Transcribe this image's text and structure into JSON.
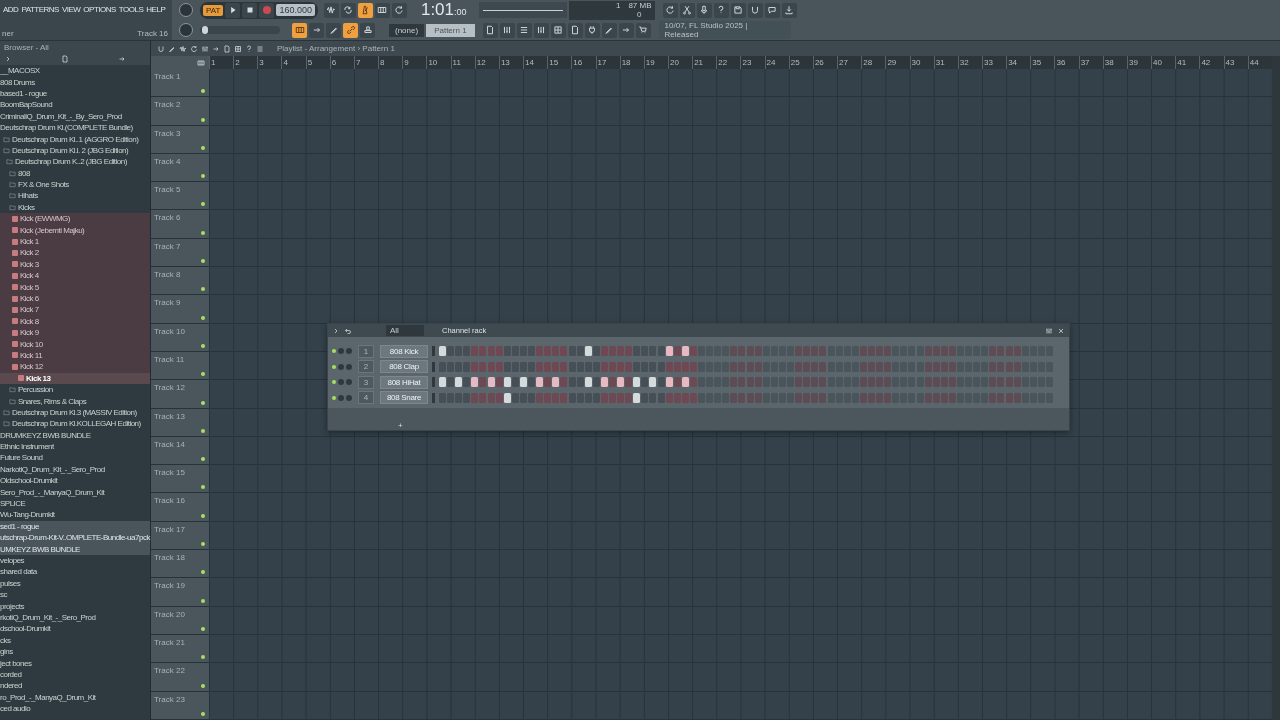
{
  "menu": [
    "ADD",
    "PATTERNS",
    "VIEW",
    "OPTIONS",
    "TOOLS",
    "HELP"
  ],
  "hint_bar": {
    "text": "ner",
    "track": "Track 16"
  },
  "transport": {
    "mode": "PAT",
    "tempo": "160.000",
    "time": "1:01$_{:00}$"
  },
  "toggles_top": [
    {
      "on": false
    },
    {
      "on": false
    },
    {
      "on": true
    },
    {
      "on": false
    },
    {
      "on": false
    }
  ],
  "toggles_bottom": [
    {
      "on": true
    },
    {
      "on": false
    },
    {
      "on": false
    },
    {
      "on": true
    },
    {
      "on": false
    }
  ],
  "master_pitch": {
    "level": 0.03
  },
  "pattern_picker": {
    "snap": "(none)",
    "pattern": "Pattern 1"
  },
  "monitor": {
    "cpu": "1",
    "memory": "87 MB",
    "voices": "0"
  },
  "news": {
    "line_1": "10/07, FL Studio 2025 |",
    "line_2": "Released"
  },
  "browser": {
    "title": "Browser - All",
    "tree": [
      {
        "label": "__MACOSX",
        "kind": "plain",
        "selected": false
      },
      {
        "label": "808 Drums",
        "kind": "plain",
        "selected": false
      },
      {
        "label": "based1 - rogue",
        "kind": "plain",
        "selected": false
      },
      {
        "label": "BoomBapSound",
        "kind": "plain",
        "selected": false
      },
      {
        "label": "CriminaliQ_Drum_Kit_-_By_Sero_Prod",
        "kind": "plain",
        "selected": false
      },
      {
        "label": "Deutschrap Drum Kl.(COMPLETE Bundle)",
        "kind": "plain",
        "selected": false,
        "children": [
          {
            "label": "Deutschrap Drum Kl..1 (AGGRO Edition)",
            "kind": "folder",
            "selected": false
          },
          {
            "label": "Deutschrap Drum Kl.l. 2 (JBG Edition)",
            "kind": "folder",
            "selected": false,
            "children": [
              {
                "label": "Deutschrap Drum K..2 (JBG Edition)",
                "kind": "folder",
                "selected": false,
                "children": [
                  {
                    "label": "808",
                    "kind": "folder",
                    "selected": false
                  },
                  {
                    "label": "FX & One Shots",
                    "kind": "folder",
                    "selected": false
                  },
                  {
                    "label": "Hihats",
                    "kind": "folder",
                    "selected": false
                  },
                  {
                    "label": "Kicks",
                    "kind": "folder",
                    "selected": false,
                    "children": [
                      {
                        "label": "Kick (EWWMG)",
                        "kind": "file",
                        "selected": false
                      },
                      {
                        "label": "Kick (Jebemti Majku)",
                        "kind": "file",
                        "selected": false
                      },
                      {
                        "label": "Kick 1",
                        "kind": "file",
                        "selected": false
                      },
                      {
                        "label": "Kick 2",
                        "kind": "file",
                        "selected": false
                      },
                      {
                        "label": "Kick 3",
                        "kind": "file",
                        "selected": false
                      },
                      {
                        "label": "Kick 4",
                        "kind": "file",
                        "selected": false
                      },
                      {
                        "label": "Kick 5",
                        "kind": "file",
                        "selected": false
                      },
                      {
                        "label": "Kick 6",
                        "kind": "file",
                        "selected": false
                      },
                      {
                        "label": "Kick 7",
                        "kind": "file",
                        "selected": false
                      },
                      {
                        "label": "Kick 8",
                        "kind": "file",
                        "selected": false
                      },
                      {
                        "label": "Kick 9",
                        "kind": "file",
                        "selected": false
                      },
                      {
                        "label": "Kick 10",
                        "kind": "file",
                        "selected": false
                      },
                      {
                        "label": "Kick 11",
                        "kind": "file",
                        "selected": false
                      },
                      {
                        "label": "Kick 12",
                        "kind": "file",
                        "selected": false
                      },
                      {
                        "label": "Kick 13",
                        "kind": "file",
                        "selected": true
                      }
                    ]
                  },
                  {
                    "label": "Percussion",
                    "kind": "folder",
                    "selected": false
                  },
                  {
                    "label": "Snares, Rims & Claps",
                    "kind": "folder",
                    "selected": false
                  }
                ]
              }
            ]
          },
          {
            "label": "Deutschrap Drum Kl.3 (MASSIV Edition)",
            "kind": "folder",
            "selected": false
          },
          {
            "label": "Deutschrap Drum Kl.KOLLEGAH Edition)",
            "kind": "folder",
            "selected": false
          }
        ]
      },
      {
        "label": "DRUMKEYZ BWB BUNDLE",
        "kind": "plain",
        "selected": false
      },
      {
        "label": "Ethnic Instrument",
        "kind": "plain",
        "selected": false
      },
      {
        "label": "Future Sound",
        "kind": "plain",
        "selected": false
      },
      {
        "label": "NarkotiQ_Drum_Kit_-_Sero_Prod",
        "kind": "plain",
        "selected": false
      },
      {
        "label": "Oldschool-Drumkit",
        "kind": "plain",
        "selected": false
      },
      {
        "label": "Sero_Prod_-_ManyaQ_Drum_Kit",
        "kind": "plain",
        "selected": false
      },
      {
        "label": "SPLICE",
        "kind": "plain",
        "selected": false
      },
      {
        "label": "Wu-Tang-Drumkit",
        "kind": "plain",
        "selected": false
      },
      {
        "label": "sed1 - rogue",
        "kind": "recent",
        "selected": false
      },
      {
        "label": "utschrap-Drum-Kit-V..OMPLETE-Bundle-ua7pck",
        "kind": "recent",
        "selected": false
      },
      {
        "label": "UMKEYZ BWB BUNDLE",
        "kind": "recent",
        "selected": false
      },
      {
        "label": "velopes",
        "kind": "plain",
        "selected": false
      },
      {
        "label": "shared data",
        "kind": "plain",
        "selected": false
      },
      {
        "label": "pulses",
        "kind": "plain",
        "selected": false
      },
      {
        "label": "sc",
        "kind": "plain",
        "selected": false
      },
      {
        "label": "projects",
        "kind": "plain",
        "selected": false
      },
      {
        "label": "rkotiQ_Drum_Kit_-_Sero_Prod",
        "kind": "plain",
        "selected": false
      },
      {
        "label": "dschool-Drumkit",
        "kind": "plain",
        "selected": false
      },
      {
        "label": "cks",
        "kind": "plain",
        "selected": false
      },
      {
        "label": "gins",
        "kind": "plain",
        "selected": false
      },
      {
        "label": "ject bones",
        "kind": "plain",
        "selected": false
      },
      {
        "label": "corded",
        "kind": "plain",
        "selected": false
      },
      {
        "label": "ndered",
        "kind": "plain",
        "selected": false
      },
      {
        "label": "ro_Prod_-_ManyaQ_Drum_Kit",
        "kind": "plain",
        "selected": false
      },
      {
        "label": "ced audio",
        "kind": "plain",
        "selected": false
      }
    ]
  },
  "playlist": {
    "title": "Playlist - Arrangement › Pattern 1",
    "ruler": [
      "1",
      "2",
      "3",
      "4",
      "5",
      "6",
      "7",
      "8",
      "9",
      "10",
      "11",
      "12",
      "13",
      "14",
      "15",
      "16",
      "17",
      "18",
      "19",
      "20",
      "21",
      "22",
      "23",
      "24",
      "25",
      "26",
      "27",
      "28",
      "29",
      "30",
      "31",
      "32",
      "33",
      "34",
      "35",
      "36",
      "37",
      "38",
      "39",
      "40",
      "41",
      "42",
      "43",
      "44"
    ],
    "tracks": [
      {
        "name": "Track 1",
        "on": true
      },
      {
        "name": "Track 2",
        "on": true
      },
      {
        "name": "Track 3",
        "on": true
      },
      {
        "name": "Track 4",
        "on": true
      },
      {
        "name": "Track 5",
        "on": true
      },
      {
        "name": "Track 6",
        "on": true
      },
      {
        "name": "Track 7",
        "on": true
      },
      {
        "name": "Track 8",
        "on": true
      },
      {
        "name": "Track 9",
        "on": true
      },
      {
        "name": "Track 10",
        "on": true
      },
      {
        "name": "Track 11",
        "on": true
      },
      {
        "name": "Track 12",
        "on": true
      },
      {
        "name": "Track 13",
        "on": true
      },
      {
        "name": "Track 14",
        "on": true
      },
      {
        "name": "Track 15",
        "on": true
      },
      {
        "name": "Track 16",
        "on": true
      },
      {
        "name": "Track 17",
        "on": true
      },
      {
        "name": "Track 18",
        "on": true
      },
      {
        "name": "Track 19",
        "on": true
      },
      {
        "name": "Track 20",
        "on": true
      },
      {
        "name": "Track 21",
        "on": true
      },
      {
        "name": "Track 22",
        "on": true
      },
      {
        "name": "Track 23",
        "on": true
      }
    ]
  },
  "channel_rack": {
    "filter": "All",
    "title": "Channel rack",
    "add": "+",
    "channels": [
      {
        "number": "1",
        "name": "808 Kick",
        "on": true,
        "steps": [
          true,
          false,
          false,
          false,
          false,
          false,
          false,
          false,
          false,
          false,
          false,
          false,
          false,
          false,
          false,
          false,
          false,
          false,
          true,
          false,
          false,
          false,
          false,
          false,
          false,
          false,
          false,
          false,
          true,
          false,
          true,
          false
        ]
      },
      {
        "number": "2",
        "name": "808 Clap",
        "on": true,
        "steps": [
          false,
          false,
          false,
          false,
          false,
          false,
          false,
          false,
          false,
          false,
          false,
          false,
          false,
          false,
          false,
          false,
          false,
          false,
          false,
          false,
          false,
          false,
          false,
          false,
          false,
          false,
          false,
          false,
          false,
          false,
          false,
          false
        ]
      },
      {
        "number": "3",
        "name": "808 HiHat",
        "on": true,
        "steps": [
          true,
          false,
          true,
          false,
          true,
          false,
          true,
          false,
          true,
          false,
          true,
          false,
          true,
          false,
          true,
          false,
          false,
          false,
          true,
          false,
          true,
          false,
          true,
          false,
          true,
          false,
          true,
          false,
          true,
          false,
          true,
          false
        ]
      },
      {
        "number": "4",
        "name": "808 Snare",
        "on": true,
        "steps": [
          false,
          false,
          false,
          false,
          false,
          false,
          false,
          false,
          true,
          false,
          false,
          false,
          false,
          false,
          false,
          false,
          false,
          false,
          false,
          false,
          false,
          false,
          false,
          false,
          true,
          false,
          false,
          false,
          false,
          false,
          false,
          false
        ]
      }
    ]
  }
}
